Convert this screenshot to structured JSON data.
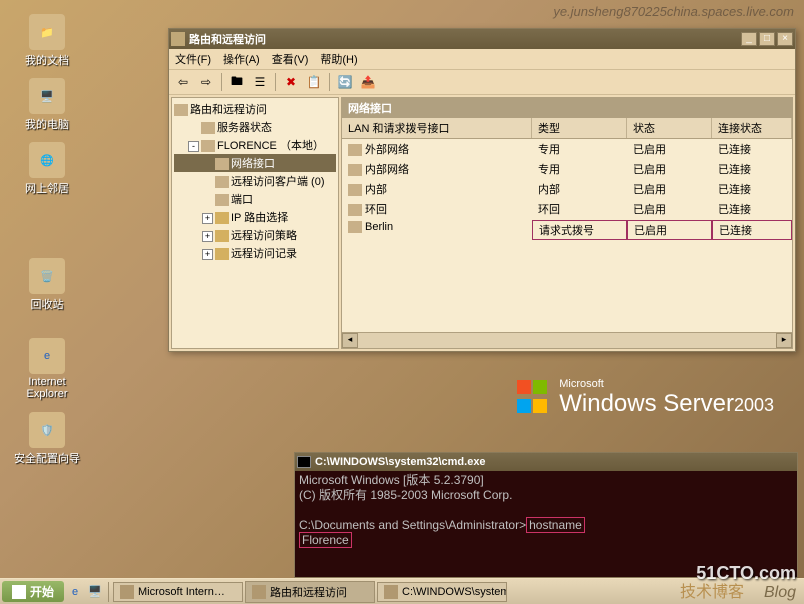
{
  "watermark": "ye.junsheng870225china.spaces.live.com",
  "bottom_watermark": "51CTO.com",
  "tech_blog": "技术博客",
  "blog_txt": "Blog",
  "desktop_icons": {
    "mydocs": "我的文档",
    "mycomputer": "我的电脑",
    "network": "网上邻居",
    "recycle": "回收站",
    "ie": "Internet Explorer",
    "secwiz": "安全配置向导"
  },
  "ws_logo": {
    "ms": "Microsoft",
    "win": "Windows Server",
    "year": "2003"
  },
  "rras": {
    "title": "路由和远程访问",
    "menus": {
      "file": "文件(F)",
      "action": "操作(A)",
      "view": "查看(V)",
      "help": "帮助(H)"
    },
    "tree": {
      "root": "路由和远程访问",
      "server_status": "服务器状态",
      "local_server": "FLORENCE （本地）",
      "net_if": "网络接口",
      "remote_clients": "远程访问客户端 (0)",
      "ports": "端口",
      "ip_routing": "IP 路由选择",
      "remote_policies": "远程访问策略",
      "remote_logging": "远程访问记录"
    },
    "list_panel_title": "网络接口",
    "columns": {
      "c0": "LAN 和请求拨号接口",
      "c1": "类型",
      "c2": "状态",
      "c3": "连接状态"
    },
    "rows": [
      {
        "name": "外部网络",
        "type": "专用",
        "status": "已启用",
        "conn": "已连接"
      },
      {
        "name": "内部网络",
        "type": "专用",
        "status": "已启用",
        "conn": "已连接"
      },
      {
        "name": "内部",
        "type": "内部",
        "status": "已启用",
        "conn": "已连接"
      },
      {
        "name": "环回",
        "type": "环回",
        "status": "已启用",
        "conn": "已连接"
      },
      {
        "name": "Berlin",
        "type": "请求式拨号",
        "status": "已启用",
        "conn": "已连接"
      }
    ]
  },
  "cmd": {
    "title": "C:\\WINDOWS\\system32\\cmd.exe",
    "line1": "Microsoft Windows [版本 5.2.3790]",
    "line2": "(C) 版权所有 1985-2003 Microsoft Corp.",
    "prompt": "C:\\Documents and Settings\\Administrator>",
    "command": "hostname",
    "output": "Florence"
  },
  "taskbar": {
    "start": "开始",
    "tasks": {
      "ie": "Microsoft Intern…",
      "rras": "路由和远程访问",
      "cmd": "C:\\WINDOWS\\system…"
    }
  }
}
